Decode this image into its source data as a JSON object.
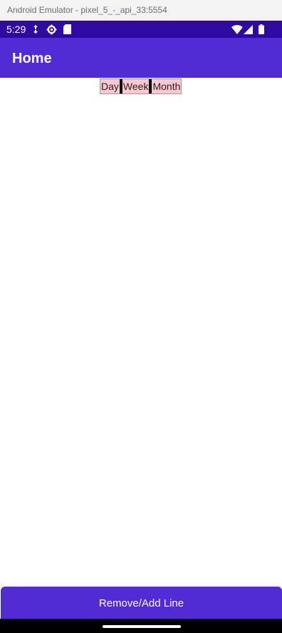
{
  "window": {
    "title": "Android Emulator - pixel_5_-_api_33:5554"
  },
  "status_bar": {
    "time": "5:29",
    "left_icons": [
      "arrows-icon",
      "gear-icon",
      "sd-card-icon"
    ],
    "right_icons": [
      "wifi-icon",
      "signal-icon",
      "battery-icon"
    ]
  },
  "app_bar": {
    "title": "Home"
  },
  "segmented_control": {
    "items": [
      "Day",
      "Week",
      "Month"
    ]
  },
  "bottom_button": {
    "label": "Remove/Add Line"
  },
  "colors": {
    "status_bar": "#2f0aa0",
    "app_bar": "#512bd4",
    "segment_bg": "#fbc8d0",
    "button_bg": "#512bd4"
  }
}
